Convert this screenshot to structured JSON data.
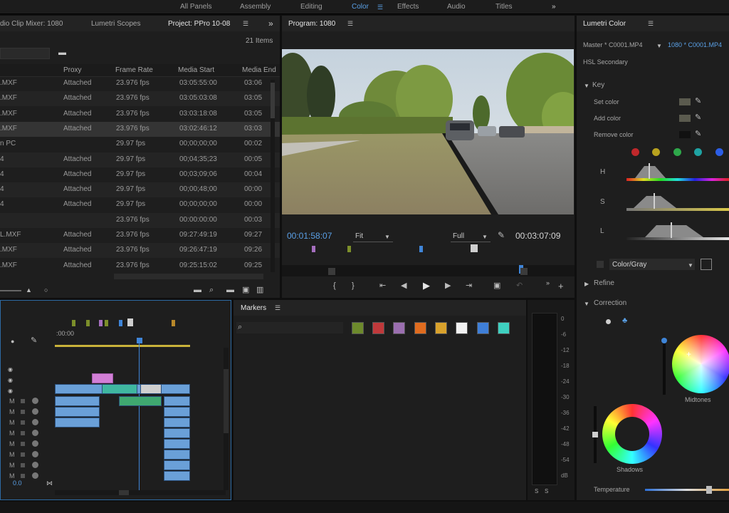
{
  "workspaces": {
    "items": [
      "All Panels",
      "Assembly",
      "Editing",
      "Color",
      "Effects",
      "Audio",
      "Titles"
    ],
    "active": "Color",
    "more": "»"
  },
  "project_panel": {
    "tabs": [
      "dio Clip Mixer: 1080",
      "Lumetri Scopes",
      "Project: PPro 10-08"
    ],
    "items_count": "21 Items",
    "more": "»",
    "columns": [
      "Proxy",
      "Frame Rate",
      "Media Start",
      "Media End"
    ],
    "rows": [
      {
        "name": ".MXF",
        "proxy": "Attached",
        "fps": "23.976 fps",
        "start": "03:05:55:00",
        "end": "03:06"
      },
      {
        "name": ".MXF",
        "proxy": "Attached",
        "fps": "23.976 fps",
        "start": "03:05:03:08",
        "end": "03:05"
      },
      {
        "name": ".MXF",
        "proxy": "Attached",
        "fps": "23.976 fps",
        "start": "03:03:18:08",
        "end": "03:05"
      },
      {
        "name": ".MXF",
        "proxy": "Attached",
        "fps": "23.976 fps",
        "start": "03:02:46:12",
        "end": "03:03"
      },
      {
        "name": "n PC",
        "proxy": "",
        "fps": "29.97 fps",
        "start": "00;00;00;00",
        "end": "00:02"
      },
      {
        "name": "4",
        "proxy": "Attached",
        "fps": "29.97 fps",
        "start": "00;04;35;23",
        "end": "00:05"
      },
      {
        "name": "4",
        "proxy": "Attached",
        "fps": "29.97 fps",
        "start": "00;03;09;06",
        "end": "00:04"
      },
      {
        "name": "4",
        "proxy": "Attached",
        "fps": "29.97 fps",
        "start": "00;00;48;00",
        "end": "00:00"
      },
      {
        "name": "4",
        "proxy": "Attached",
        "fps": "29.97 fps",
        "start": "00;00;00;00",
        "end": "00:00"
      },
      {
        "name": "",
        "proxy": "",
        "fps": "23.976 fps",
        "start": "00:00:00:00",
        "end": "00:03"
      },
      {
        "name": "L.MXF",
        "proxy": "Attached",
        "fps": "23.976 fps",
        "start": "09:27:49:19",
        "end": "09:27"
      },
      {
        "name": ".MXF",
        "proxy": "Attached",
        "fps": "23.976 fps",
        "start": "09:26:47:19",
        "end": "09:26"
      },
      {
        "name": ".MXF",
        "proxy": "Attached",
        "fps": "23.976 fps",
        "start": "09:25:15:02",
        "end": "09:25"
      }
    ]
  },
  "program_monitor": {
    "title": "Program: 1080",
    "timecode_current": "00:01:58:07",
    "zoom": "Fit",
    "resolution": "Full",
    "timecode_duration": "00:03:07:09"
  },
  "lumetri": {
    "title": "Lumetri Color",
    "source": "Master * C0001.MP4",
    "sequence_clip": "1080 * C0001.MP4",
    "section": "HSL Secondary",
    "key_label": "Key",
    "set_color": "Set color",
    "add_color": "Add color",
    "remove_color": "Remove color",
    "h_label": "H",
    "s_label": "S",
    "l_label": "L",
    "preview_mode": "Color/Gray",
    "refine_label": "Refine",
    "correction_label": "Correction",
    "midtones_label": "Midtones",
    "shadows_label": "Shadows",
    "temperature_label": "Temperature",
    "preset_dots": [
      "#c0282b",
      "#b8a21f",
      "#2ea84a",
      "#1fa3a3",
      "#2c5ee6"
    ]
  },
  "timeline": {
    "timecode": ":00:00",
    "value": "0.0",
    "tracks": [
      "M",
      "M",
      "M",
      "M",
      "M",
      "M",
      "M",
      "M"
    ]
  },
  "markers_panel": {
    "title": "Markers",
    "swatch_colors": [
      "#6d8a2c",
      "#c0393b",
      "#9b6fb0",
      "#e06c1f",
      "#d9a22c",
      "#f2f2f2",
      "#3f7fd8",
      "#3fd0c0"
    ]
  },
  "audio_meter": {
    "scale": [
      "0",
      "-6",
      "-12",
      "-18",
      "-24",
      "-30",
      "-36",
      "-42",
      "-48",
      "-54",
      "dB"
    ],
    "solo": [
      "S",
      "S"
    ]
  }
}
